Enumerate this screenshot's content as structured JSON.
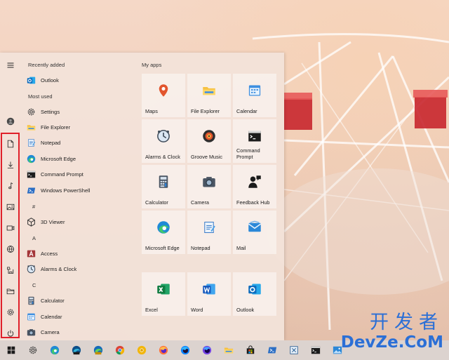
{
  "start_menu": {
    "recently_added_label": "Recently added",
    "most_used_label": "Most used",
    "recent_apps": [
      {
        "label": "Outlook",
        "icon": "outlook-icon"
      }
    ],
    "most_used_apps": [
      {
        "label": "Settings",
        "icon": "gear-icon"
      },
      {
        "label": "File Explorer",
        "icon": "folder-icon"
      },
      {
        "label": "Notepad",
        "icon": "notepad-icon"
      },
      {
        "label": "Microsoft Edge",
        "icon": "edge-icon"
      },
      {
        "label": "Command Prompt",
        "icon": "terminal-icon"
      },
      {
        "label": "Windows PowerShell",
        "icon": "powershell-icon"
      }
    ],
    "letters": {
      "hash": "#",
      "a": "A",
      "c": "C"
    },
    "hash_apps": [
      {
        "label": "3D Viewer",
        "icon": "cube-icon"
      }
    ],
    "a_apps": [
      {
        "label": "Access",
        "icon": "access-icon"
      },
      {
        "label": "Alarms & Clock",
        "icon": "clock-icon"
      }
    ],
    "c_apps": [
      {
        "label": "Calculator",
        "icon": "calculator-icon"
      },
      {
        "label": "Calendar",
        "icon": "calendar-icon"
      },
      {
        "label": "Camera",
        "icon": "camera-icon"
      }
    ],
    "tiles_group_title": "My apps",
    "tiles": [
      {
        "label": "Maps",
        "icon": "map-pin-icon"
      },
      {
        "label": "File Explorer",
        "icon": "folder-icon"
      },
      {
        "label": "Calendar",
        "icon": "calendar-icon"
      },
      {
        "label": "Alarms & Clock",
        "icon": "clock-icon"
      },
      {
        "label": "Groove Music",
        "icon": "music-disc-icon"
      },
      {
        "label": "Command\nPrompt",
        "icon": "terminal-icon"
      },
      {
        "label": "Calculator",
        "icon": "calculator-icon"
      },
      {
        "label": "Camera",
        "icon": "camera-icon"
      },
      {
        "label": "Feedback Hub",
        "icon": "feedback-icon"
      },
      {
        "label": "Microsoft Edge",
        "icon": "edge-icon"
      },
      {
        "label": "Notepad",
        "icon": "notepad-icon"
      },
      {
        "label": "Mail",
        "icon": "mail-icon"
      },
      {
        "label": "Excel",
        "icon": "excel-icon"
      },
      {
        "label": "Word",
        "icon": "word-icon"
      },
      {
        "label": "Outlook",
        "icon": "outlook-icon"
      }
    ],
    "rail": [
      "hamburger-icon",
      "user-avatar-icon",
      "document-icon",
      "download-icon",
      "music-note-icon",
      "pictures-icon",
      "videos-icon",
      "network-icon",
      "personal-folder-icon",
      "file-explorer-icon",
      "gear-icon",
      "power-icon"
    ]
  },
  "taskbar": {
    "items": [
      "windows-start-icon",
      "gear-icon",
      "edge-icon",
      "edge-dev-icon",
      "edge-canary-icon",
      "chrome-icon",
      "chrome-canary-icon",
      "firefox-icon",
      "firefox-dev-icon",
      "firefox-nightly-icon",
      "folder-icon",
      "store-icon",
      "powershell-icon",
      "snipping-tool-icon",
      "terminal-icon",
      "photos-icon"
    ]
  },
  "watermark": {
    "cn": "开发者",
    "en": "DevZe.CoM"
  },
  "colors": {
    "highlight": "#e0202a",
    "accent": "#0078d4",
    "watermark": "#2b6fd6"
  }
}
